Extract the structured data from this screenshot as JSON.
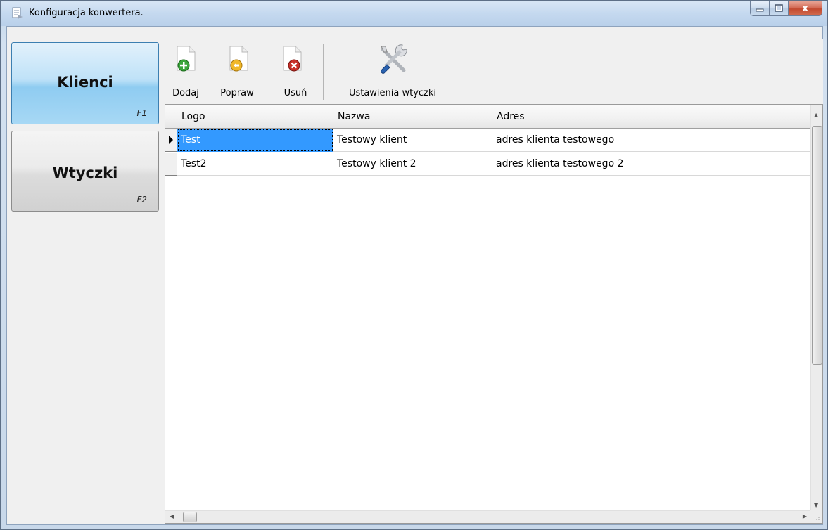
{
  "window": {
    "title": "Konfiguracja konwertera.",
    "close_glyph": "x"
  },
  "nav": {
    "items": [
      {
        "label": "Klienci",
        "shortcut": "F1",
        "active": true
      },
      {
        "label": "Wtyczki",
        "shortcut": "F2",
        "active": false
      }
    ]
  },
  "toolbar": {
    "add_label": "Dodaj",
    "edit_label": "Popraw",
    "delete_label": "Usuń",
    "plugin_settings_label": "Ustawienia wtyczki",
    "icons": [
      "document-add-icon",
      "document-edit-icon",
      "document-delete-icon",
      "tools-icon"
    ]
  },
  "grid": {
    "columns": [
      "Logo",
      "Nazwa",
      "Adres"
    ],
    "rows": [
      {
        "logo": "Test",
        "nazwa": "Testowy klient",
        "adres": "adres klienta testowego",
        "selected": true
      },
      {
        "logo": "Test2",
        "nazwa": "Testowy klient 2",
        "adres": "adres klienta testowego 2",
        "selected": false
      }
    ]
  },
  "colors": {
    "active_nav": "#8fccf1",
    "selection": "#3399ff",
    "add_green": "#3aa43a",
    "edit_yellow": "#f0b82a",
    "delete_red": "#c8302a"
  }
}
